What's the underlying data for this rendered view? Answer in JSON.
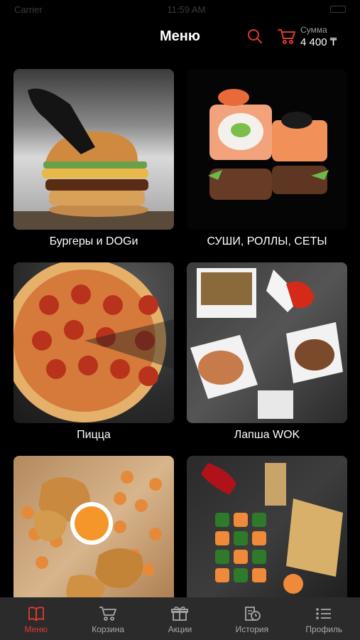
{
  "status_bar": {
    "carrier": "Carrier",
    "time": "11:59 AM"
  },
  "header": {
    "title": "Меню",
    "sum_label": "Сумма",
    "sum_value": "4 400 ₸"
  },
  "categories": [
    {
      "label": "Бургеры и DOGи",
      "image": "burger"
    },
    {
      "label": "СУШИ, РОЛЛЫ, СЕТЫ",
      "image": "sushi"
    },
    {
      "label": "Пицца",
      "image": "pizza"
    },
    {
      "label": "Лапша WOK",
      "image": "wok"
    },
    {
      "label": "",
      "image": "chicken"
    },
    {
      "label": "",
      "image": "combo"
    }
  ],
  "tabs": [
    {
      "label": "Меню",
      "icon": "book-icon",
      "active": true
    },
    {
      "label": "Корзина",
      "icon": "cart-icon",
      "active": false
    },
    {
      "label": "Акции",
      "icon": "gift-icon",
      "active": false
    },
    {
      "label": "История",
      "icon": "history-icon",
      "active": false
    },
    {
      "label": "Профиль",
      "icon": "list-icon",
      "active": false
    }
  ],
  "colors": {
    "accent": "#e03a2f",
    "background": "#000000",
    "tabbar": "#2b2b2b",
    "inactive": "#a8a8a8"
  }
}
